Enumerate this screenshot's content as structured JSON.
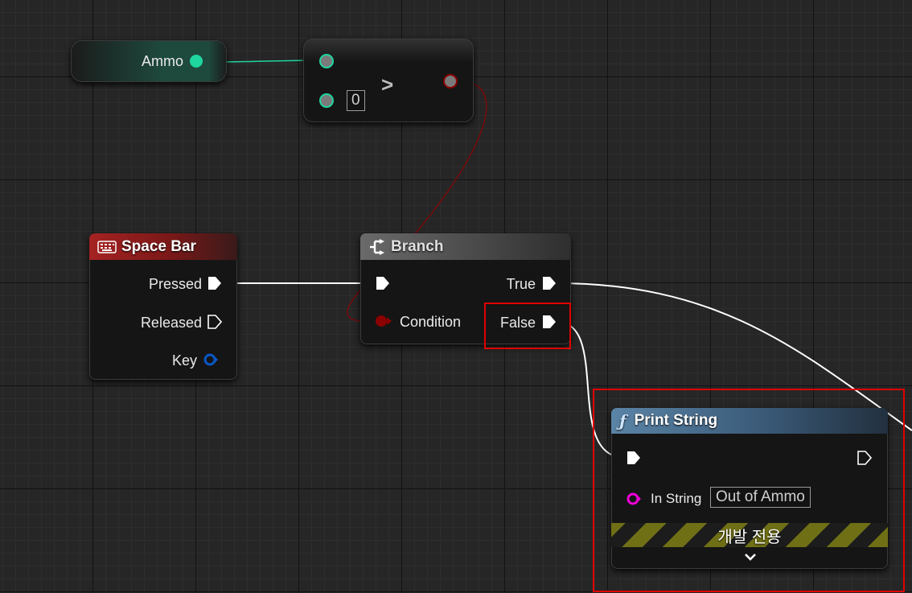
{
  "ammo_var": {
    "label": "Ammo"
  },
  "greater_node": {
    "operator": ">",
    "b_value": "0"
  },
  "space_bar_node": {
    "title": "Space Bar",
    "pins": {
      "pressed": "Pressed",
      "released": "Released",
      "key": "Key"
    }
  },
  "branch_node": {
    "title": "Branch",
    "pins": {
      "condition": "Condition",
      "true": "True",
      "false": "False"
    }
  },
  "print_string_node": {
    "title": "Print String",
    "in_string_label": "In String",
    "in_string_value": "Out of Ammo",
    "dev_only_label": "개발 전용"
  },
  "colors": {
    "integer_pin": "#1fd6a0",
    "boolean_pin": "#8b0000",
    "struct_pin": "#0a56c4",
    "string_pin": "#f000d8",
    "exec_wire": "#ffffff",
    "highlight": "#e00000",
    "function_header": "#3a5a78",
    "event_header": "#8b1a1a",
    "branch_header": "#4a4a4a"
  }
}
